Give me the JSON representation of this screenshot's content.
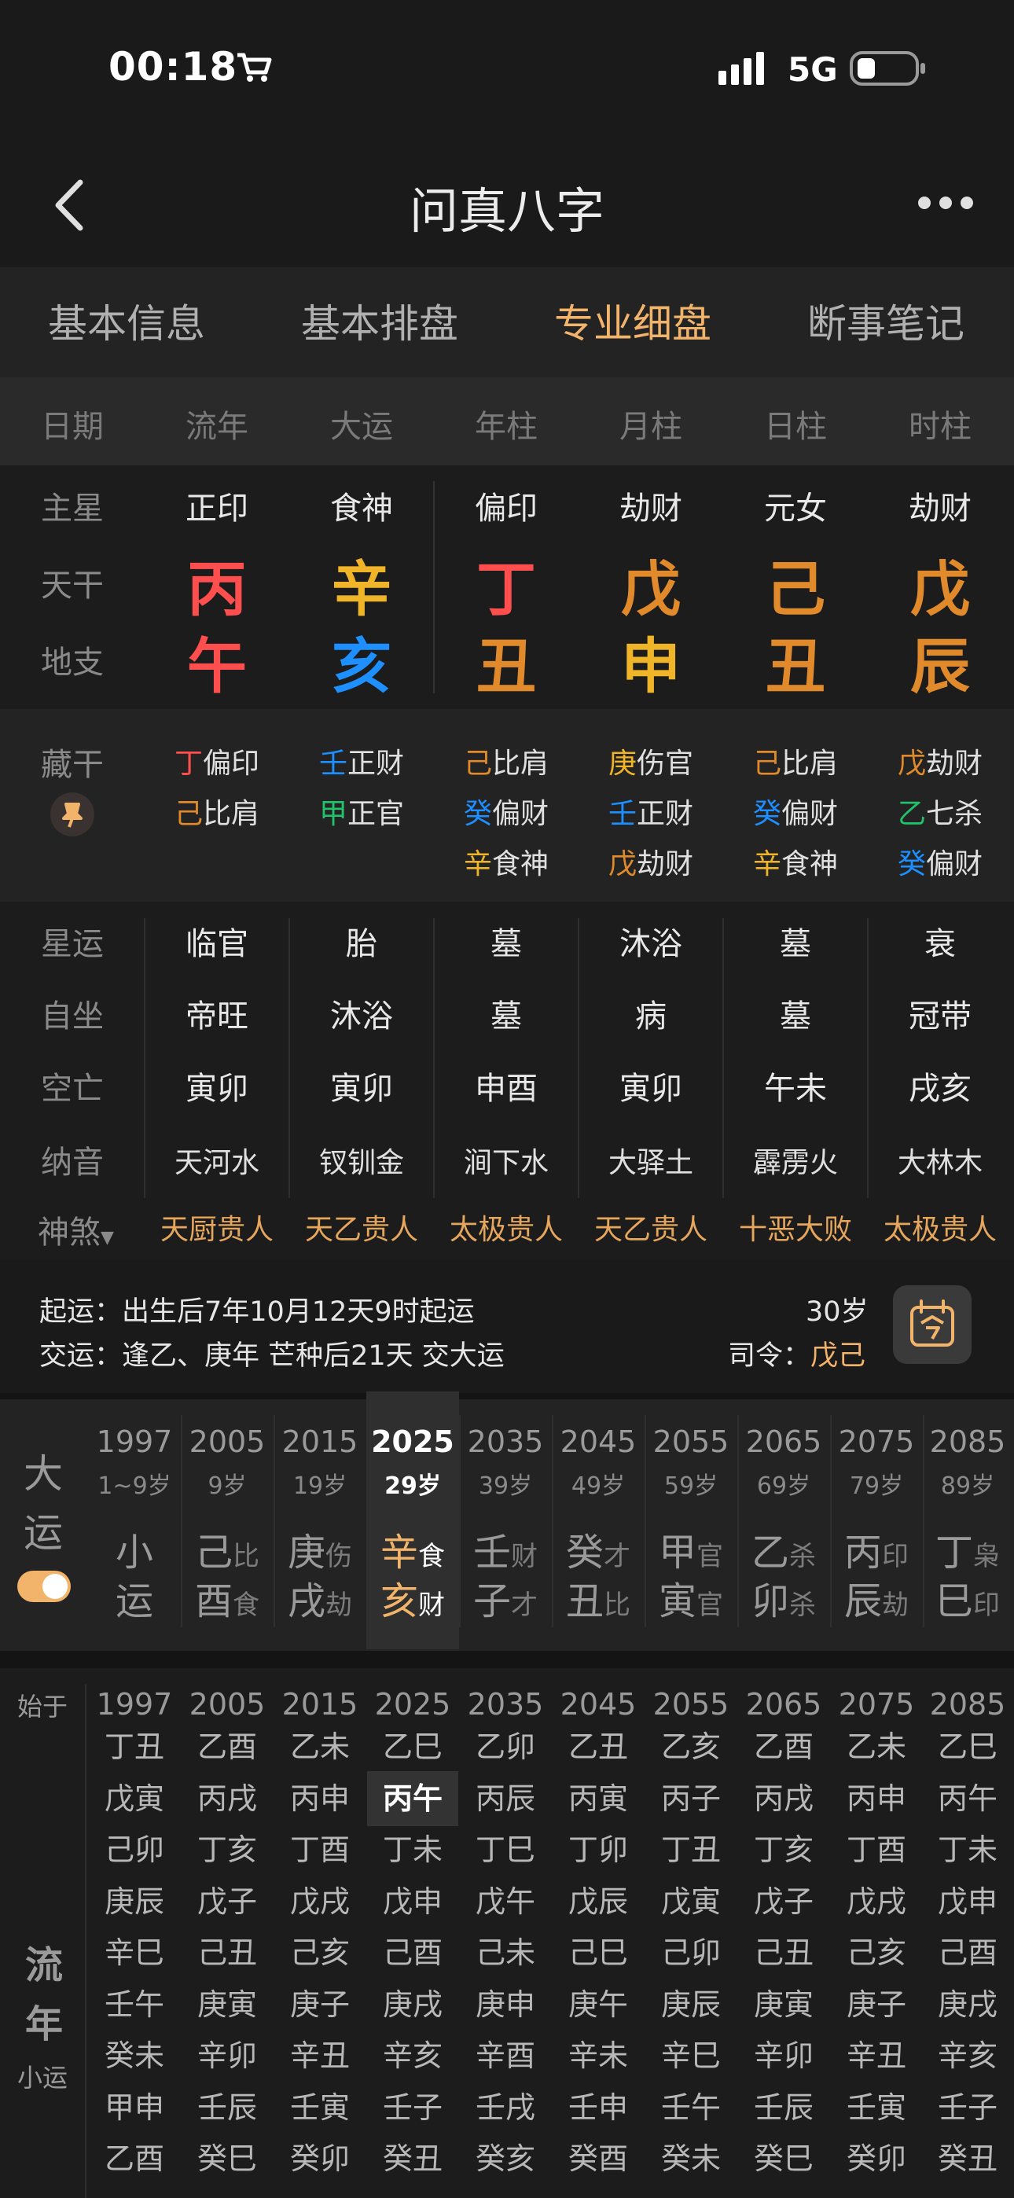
{
  "status": {
    "time": "00:18",
    "network": "5G",
    "battery": "26%"
  },
  "nav": {
    "title": "问真八字",
    "back": "back",
    "more": "more"
  },
  "tabs": [
    "基本信息",
    "基本排盘",
    "专业细盘",
    "断事笔记"
  ],
  "columns": [
    "日期",
    "流年",
    "大运",
    "年柱",
    "月柱",
    "日柱",
    "时柱"
  ],
  "rowLabels": {
    "zhuxing": "主星",
    "tiangan": "天干",
    "dizhi": "地支",
    "canggan": "藏干",
    "xingyun": "星运",
    "zizuo": "自坐",
    "kongwang": "空亡",
    "nayin": "纳音",
    "shensha": "神煞"
  },
  "zhuxing": [
    "正印",
    "食神",
    "偏印",
    "劫财",
    "元女",
    "劫财"
  ],
  "tiangan": [
    "丙",
    "辛",
    "丁",
    "戊",
    "己",
    "戊"
  ],
  "dizhi": [
    "午",
    "亥",
    "丑",
    "申",
    "丑",
    "辰"
  ],
  "canggan": [
    [
      {
        "g": "丁",
        "t": "偏印"
      },
      {
        "g": "己",
        "t": "比肩"
      }
    ],
    [
      {
        "g": "壬",
        "t": "正财"
      },
      {
        "g": "甲",
        "t": "正官"
      }
    ],
    [
      {
        "g": "己",
        "t": "比肩"
      },
      {
        "g": "癸",
        "t": "偏财"
      },
      {
        "g": "辛",
        "t": "食神"
      }
    ],
    [
      {
        "g": "庚",
        "t": "伤官"
      },
      {
        "g": "壬",
        "t": "正财"
      },
      {
        "g": "戊",
        "t": "劫财"
      }
    ],
    [
      {
        "g": "己",
        "t": "比肩"
      },
      {
        "g": "癸",
        "t": "偏财"
      },
      {
        "g": "辛",
        "t": "食神"
      }
    ],
    [
      {
        "g": "戊",
        "t": "劫财"
      },
      {
        "g": "乙",
        "t": "七杀"
      },
      {
        "g": "癸",
        "t": "偏财"
      }
    ]
  ],
  "xingyun": [
    "临官",
    "胎",
    "墓",
    "沐浴",
    "墓",
    "衰"
  ],
  "zizuo": [
    "帝旺",
    "沐浴",
    "墓",
    "病",
    "墓",
    "冠带"
  ],
  "kongwang": [
    "寅卯",
    "寅卯",
    "申酉",
    "寅卯",
    "午未",
    "戌亥"
  ],
  "nayin": [
    "天河水",
    "钗钏金",
    "涧下水",
    "大驿土",
    "霹雳火",
    "大林木"
  ],
  "shensha": [
    "天厨贵人",
    "天乙贵人",
    "太极贵人",
    "天乙贵人",
    "十恶大败",
    "太极贵人"
  ],
  "qiyun": {
    "line1": "起运：出生后7年10月12天9时起运",
    "line2": "交运：逢乙、庚年 芒种后21天 交大运",
    "age": "30岁",
    "siling_label": "司令：",
    "siling_value": "戊己"
  },
  "dayun": {
    "label1": "大",
    "label2": "运",
    "cols": [
      {
        "year": "1997",
        "age": "1~9岁",
        "g": "小",
        "gs": "",
        "z": "运",
        "zs": ""
      },
      {
        "year": "2005",
        "age": "9岁",
        "g": "己",
        "gs": "比",
        "z": "酉",
        "zs": "食"
      },
      {
        "year": "2015",
        "age": "19岁",
        "g": "庚",
        "gs": "伤",
        "z": "戌",
        "zs": "劫"
      },
      {
        "year": "2025",
        "age": "29岁",
        "g": "辛",
        "gs": "食",
        "z": "亥",
        "zs": "财"
      },
      {
        "year": "2035",
        "age": "39岁",
        "g": "壬",
        "gs": "财",
        "z": "子",
        "zs": "才"
      },
      {
        "year": "2045",
        "age": "49岁",
        "g": "癸",
        "gs": "才",
        "z": "丑",
        "zs": "比"
      },
      {
        "year": "2055",
        "age": "59岁",
        "g": "甲",
        "gs": "官",
        "z": "寅",
        "zs": "官"
      },
      {
        "year": "2065",
        "age": "69岁",
        "g": "乙",
        "gs": "杀",
        "z": "卯",
        "zs": "杀"
      },
      {
        "year": "2075",
        "age": "79岁",
        "g": "丙",
        "gs": "印",
        "z": "辰",
        "zs": "劫"
      },
      {
        "year": "2085",
        "age": "89岁",
        "g": "丁",
        "gs": "枭",
        "z": "巳",
        "zs": "印"
      }
    ]
  },
  "liunian": {
    "start": "始于",
    "label1": "流",
    "label2": "年",
    "xiaoyun": "小运",
    "years": [
      "1997",
      "2005",
      "2015",
      "2025",
      "2035",
      "2045",
      "2055",
      "2065",
      "2075",
      "2085"
    ],
    "cols": [
      [
        "丁丑",
        "戊寅",
        "己卯",
        "庚辰",
        "辛巳",
        "壬午",
        "癸未",
        "甲申",
        "乙酉"
      ],
      [
        "乙酉",
        "丙戌",
        "丁亥",
        "戊子",
        "己丑",
        "庚寅",
        "辛卯",
        "壬辰",
        "癸巳"
      ],
      [
        "乙未",
        "丙申",
        "丁酉",
        "戊戌",
        "己亥",
        "庚子",
        "辛丑",
        "壬寅",
        "癸卯"
      ],
      [
        "乙巳",
        "丙午",
        "丁未",
        "戊申",
        "己酉",
        "庚戌",
        "辛亥",
        "壬子",
        "癸丑"
      ],
      [
        "乙卯",
        "丙辰",
        "丁巳",
        "戊午",
        "己未",
        "庚申",
        "辛酉",
        "壬戌",
        "癸亥"
      ],
      [
        "乙丑",
        "丙寅",
        "丁卯",
        "戊辰",
        "己巳",
        "庚午",
        "辛未",
        "壬申",
        "癸酉"
      ],
      [
        "乙亥",
        "丙子",
        "丁丑",
        "戊寅",
        "己卯",
        "庚辰",
        "辛巳",
        "壬午",
        "癸未"
      ],
      [
        "乙酉",
        "丙戌",
        "丁亥",
        "戊子",
        "己丑",
        "庚寅",
        "辛卯",
        "壬辰",
        "癸巳"
      ],
      [
        "乙未",
        "丙申",
        "丁酉",
        "戊戌",
        "己亥",
        "庚子",
        "辛丑",
        "壬寅",
        "癸卯"
      ],
      [
        "乙巳",
        "丙午",
        "丁未",
        "戊申",
        "己酉",
        "庚戌",
        "辛亥",
        "壬子",
        "癸丑"
      ]
    ]
  },
  "colors": {
    "fire": "#ff4e4e",
    "metal": "#f0b429",
    "earth": "#e08a2c",
    "water": "#1e8fff",
    "wood": "#21c26b",
    "accent": "#f2b36b"
  }
}
